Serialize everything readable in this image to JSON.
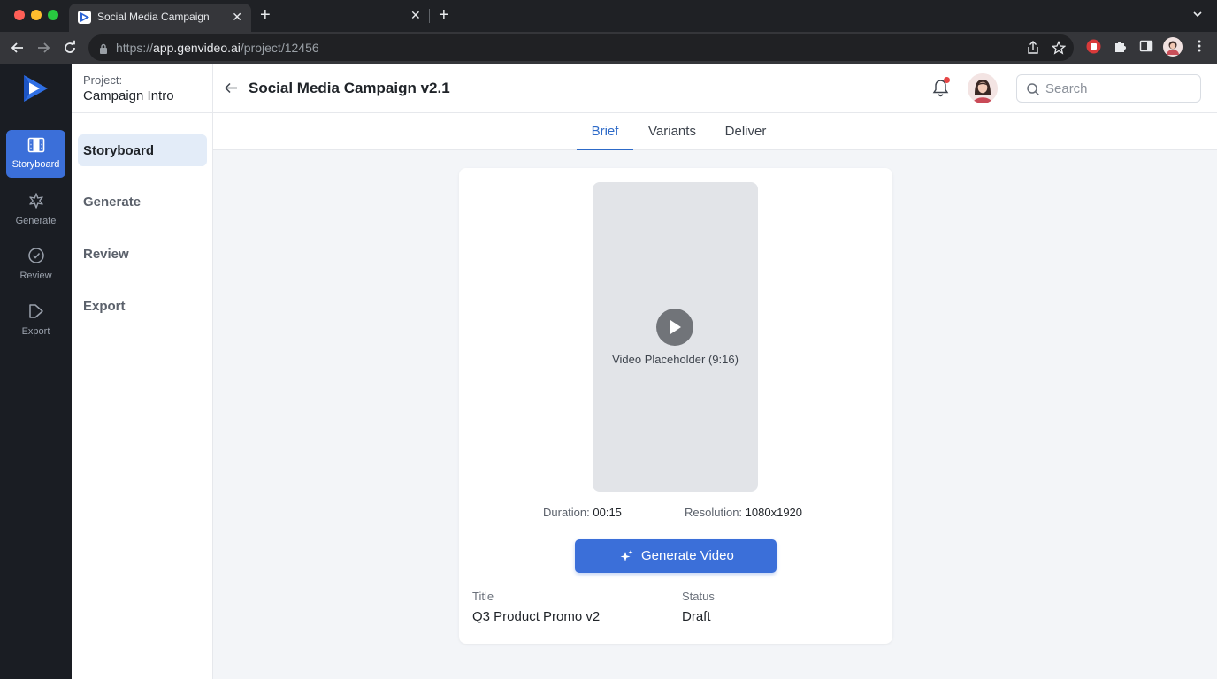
{
  "browser": {
    "tab_title": "Social Media Campaign",
    "url_scheme": "https://",
    "url_host": "app.genvideo.ai",
    "url_path": "/project/12456"
  },
  "project": {
    "label": "Project:",
    "name": "Campaign Intro"
  },
  "rail": {
    "items": [
      {
        "label": "Storyboard",
        "icon": "film-icon",
        "active": true
      },
      {
        "label": "Generate",
        "icon": "sparkle-icon",
        "active": false
      },
      {
        "label": "Review",
        "icon": "check-circle-icon",
        "active": false
      },
      {
        "label": "Export",
        "icon": "export-icon",
        "active": false
      }
    ]
  },
  "subnav": {
    "items": [
      {
        "label": "Storyboard",
        "active": true
      },
      {
        "label": "Generate",
        "active": false
      },
      {
        "label": "Review",
        "active": false
      },
      {
        "label": "Export",
        "active": false
      }
    ]
  },
  "header": {
    "title": "Social Media Campaign v2.1",
    "search_placeholder": "Search"
  },
  "tabs": [
    {
      "label": "Brief",
      "active": true
    },
    {
      "label": "Variants",
      "active": false
    },
    {
      "label": "Deliver",
      "active": false
    }
  ],
  "video": {
    "placeholder": "Video Placeholder (9:16)",
    "duration_label": "Duration:",
    "duration_value": "00:15",
    "resolution_label": "Resolution:",
    "resolution_value": "1080x1920"
  },
  "actions": {
    "generate_label": "Generate Video"
  },
  "details": {
    "title_label": "Title",
    "title_value": "Q3 Product Promo v2",
    "status_label": "Status",
    "status_value": "Draft"
  },
  "colors": {
    "accent": "#3b6fd9",
    "rail_bg": "#1a1d23",
    "active_tab": "#2d6ac8",
    "notification_dot": "#e64545"
  }
}
